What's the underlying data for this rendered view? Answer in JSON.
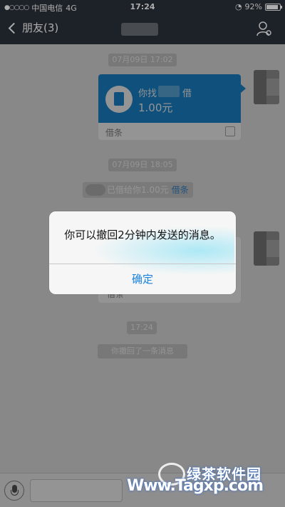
{
  "status_bar": {
    "carrier": "中国电信",
    "network": "4G",
    "time": "17:24",
    "battery": "92%"
  },
  "nav": {
    "back_label": "朋友(3)"
  },
  "chat": {
    "timestamp1": "07月09日 17:02",
    "loan_card": {
      "line1_prefix": "你找",
      "line1_suffix": "借",
      "amount": "1.00元",
      "footer": "借条"
    },
    "timestamp2": "07月09日 18:05",
    "system_message": "已借给你1.00元",
    "system_link": "借条",
    "card2_footer": "借条",
    "timestamp3": "17:24",
    "recalled": "你撤回了一条消息"
  },
  "alert": {
    "message": "你可以撤回2分钟内发送的消息。",
    "confirm": "确定"
  },
  "watermark": {
    "line1": "绿茶软件园",
    "line2": "Www.Tagxp.com"
  },
  "colors": {
    "accent": "#1a8bd6",
    "nav": "#2b313b",
    "button_text": "#1a82e0"
  }
}
